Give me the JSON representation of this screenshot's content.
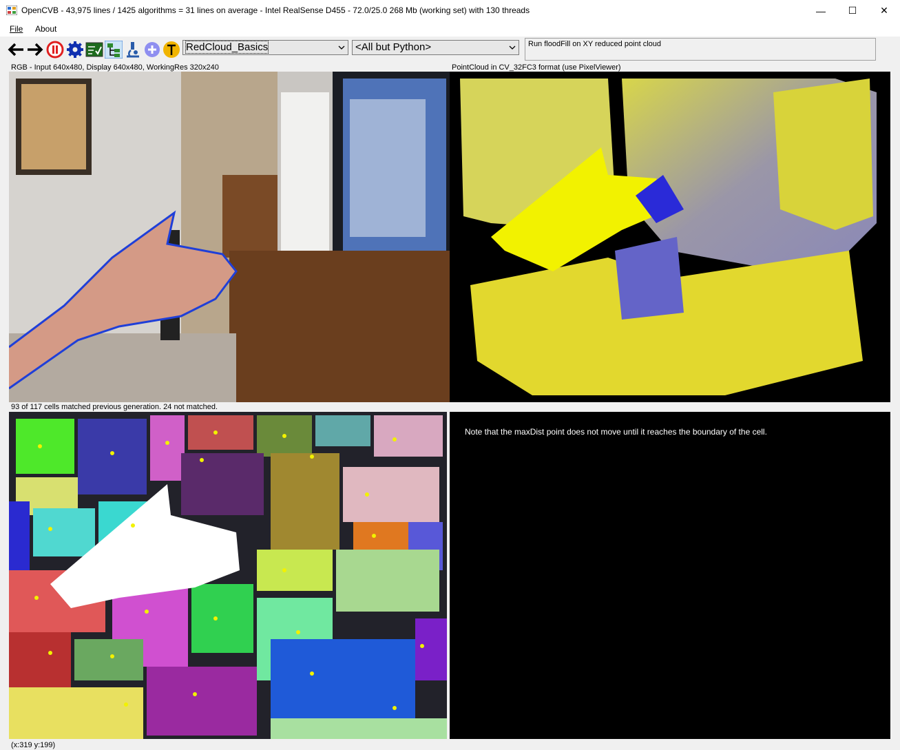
{
  "window": {
    "title": "OpenCVB - 43,975 lines / 1425 algorithms = 31 lines on average - Intel RealSense D455 - 72.0/25.0 268 Mb (working set) with 130 threads",
    "minimize": "—",
    "maximize": "☐",
    "close": "✕"
  },
  "menu": {
    "file": "File",
    "about": "About"
  },
  "toolbar": {
    "icons": [
      "back-arrow-icon",
      "forward-arrow-icon",
      "pause-icon",
      "gear-icon",
      "test-all-icon",
      "tree-view-icon",
      "microscope-icon",
      "plus-icon",
      "translator-icon"
    ],
    "algorithm_select": "RedCloud_Basics",
    "group_select": "<All but Python>",
    "description": "Run floodFill on XY reduced point cloud"
  },
  "panes": {
    "rgb_label": "RGB - Input 640x480, Display 640x480, WorkingRes 320x240",
    "pointcloud_label": "PointCloud in CV_32FC3 format (use PixelViewer)",
    "redcloud_label": "93 of 117 cells matched previous generation. 24 not matched.",
    "note": "Note that the maxDist point does not move until it reaches the boundary of the cell.",
    "mouse_coords": "(x:319 y:199)"
  },
  "colors": {
    "accent_blue": "#1f3fd8",
    "pointcloud_yellow": "#e8e42a",
    "hand_yellow": "#f2f200",
    "pause_red": "#e02020"
  }
}
